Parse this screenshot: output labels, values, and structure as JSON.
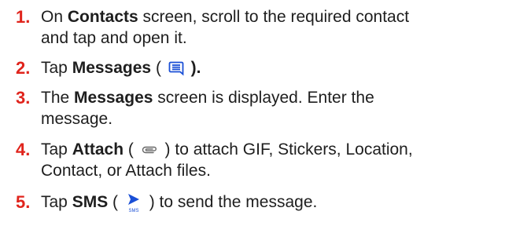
{
  "steps": [
    {
      "number": "1.",
      "line1_a": "On ",
      "line1_b": "Contacts",
      "line1_c": " screen, scroll to the required contact",
      "line2": "and tap and open it."
    },
    {
      "number": "2.",
      "a": "Tap ",
      "b": "Messages",
      "c": " ( ",
      "icon": "message-icon",
      "d": " )."
    },
    {
      "number": "3.",
      "line1_a": "The ",
      "line1_b": "Messages",
      "line1_c": " screen is displayed. Enter the",
      "line2": "message."
    },
    {
      "number": "4.",
      "line1_a": "Tap ",
      "line1_b": "Attach",
      "line1_c": " ( ",
      "icon": "paperclip-icon",
      "line1_d": " ) to attach GIF, Stickers, Location,",
      "line2": "Contact, or Attach files."
    },
    {
      "number": "5.",
      "a": "Tap ",
      "b": "SMS",
      "c": " ( ",
      "icon": "send-sms-icon",
      "icon_label": "SMS",
      "d": " ) to send the message."
    }
  ],
  "colors": {
    "number": "#e0241c",
    "text": "#1e1e1e",
    "send_icon": "#1a4fd6"
  }
}
